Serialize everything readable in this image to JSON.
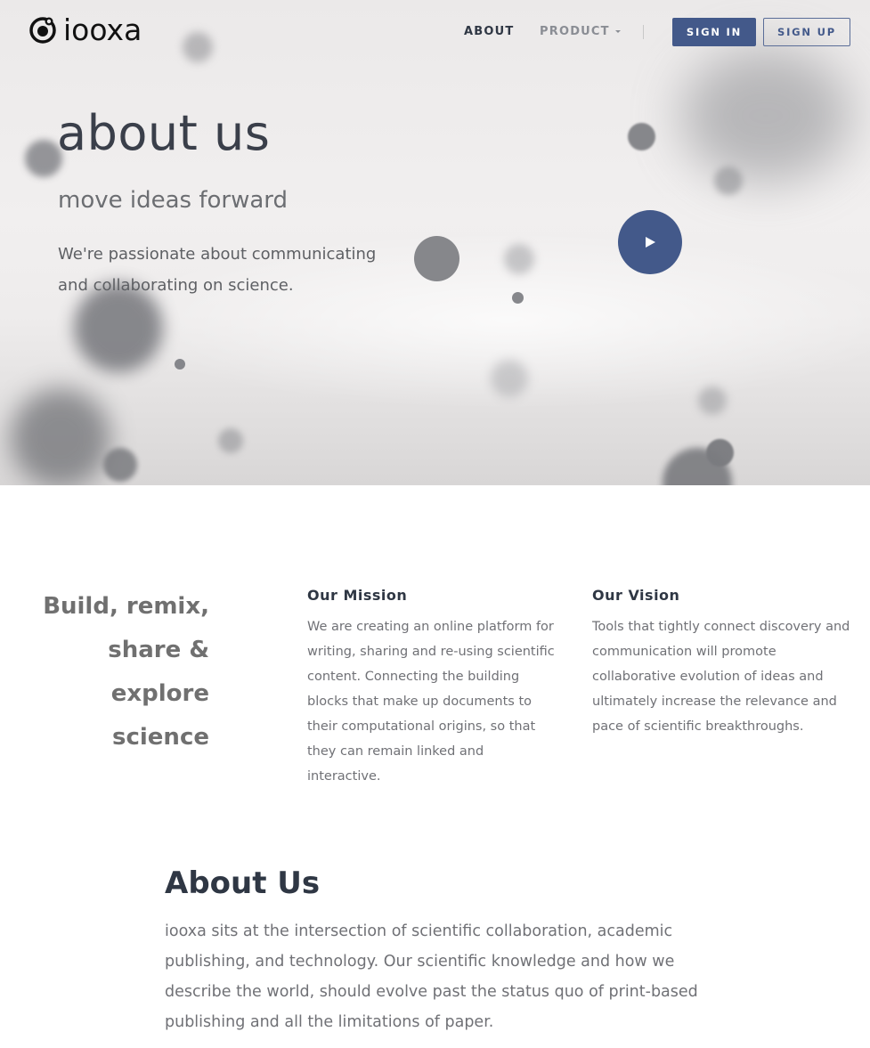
{
  "nav": {
    "logo_text": "iooxa",
    "links": [
      {
        "label": "ABOUT"
      },
      {
        "label": "PRODUCT"
      }
    ],
    "sign_in": "SIGN IN",
    "sign_up": "SIGN UP"
  },
  "hero": {
    "title": "about us",
    "subtitle": "move ideas forward",
    "text": "We're passionate about communicating and collaborating on science.",
    "play_icon": "play-icon"
  },
  "mission_section": {
    "tagline": "Build, remix, share & explore science",
    "mission": {
      "title": "Our Mission",
      "text": "We are creating an online platform for writing, sharing and re-using scientific content. Connecting the building blocks that make up documents to their computational origins, so that they can remain linked and interactive."
    },
    "vision": {
      "title": "Our Vision",
      "text": "Tools that tightly connect discovery and communication will promote collaborative evolution of ideas and ultimately increase the relevance and pace of scientific breakthroughs."
    }
  },
  "about_section": {
    "title": "About Us",
    "text": "iooxa sits at the intersection of scientific collaboration, academic publishing, and technology. Our scientific knowledge and how we describe the world, should evolve past the status quo of print-based publishing and all the limitations of paper."
  },
  "colors": {
    "brand": "#43598a",
    "text_dark": "#2f3744",
    "text_muted": "#707176"
  }
}
